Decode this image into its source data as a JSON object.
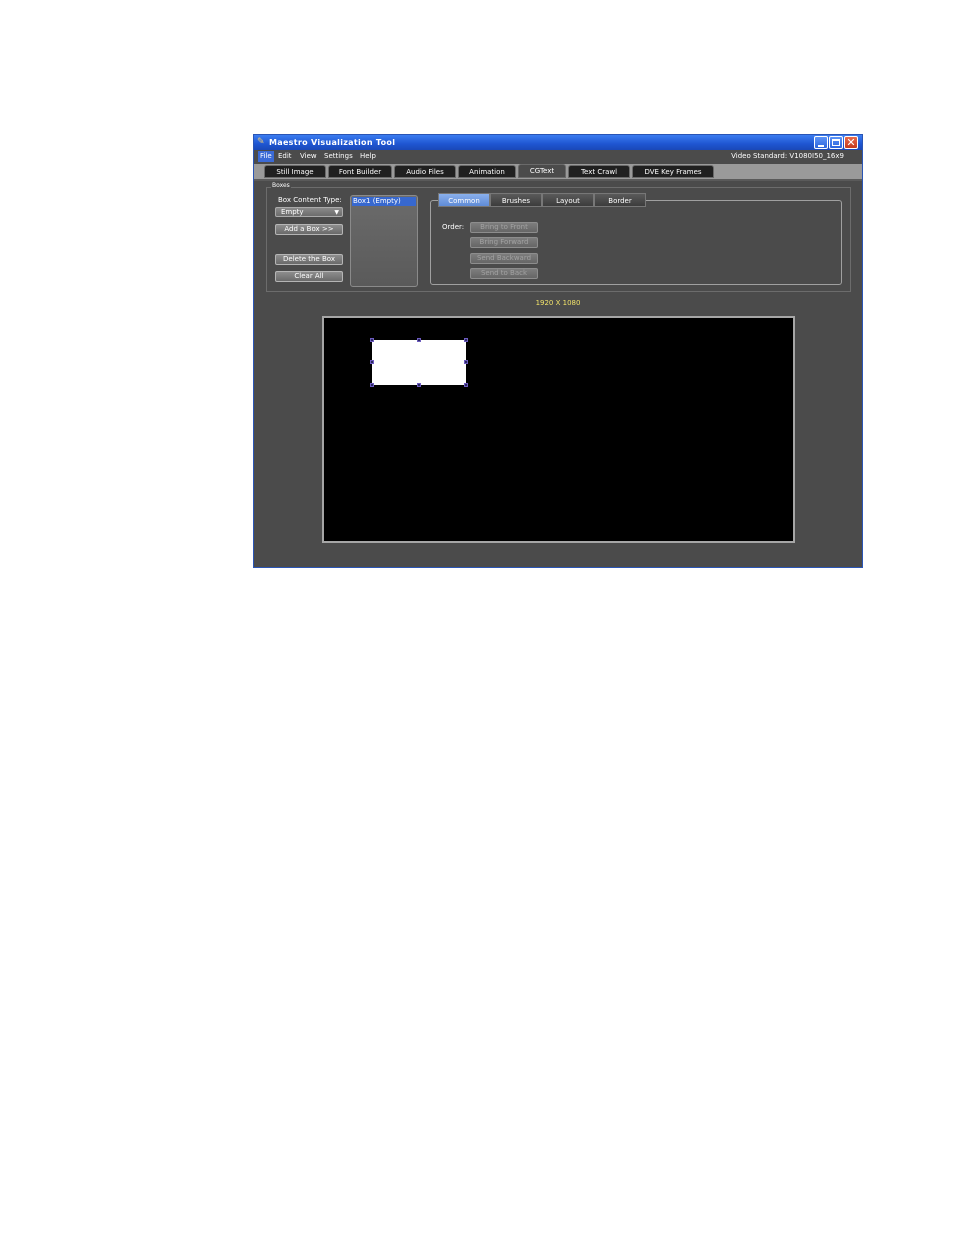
{
  "window": {
    "title": "Maestro Visualization Tool"
  },
  "menu": {
    "items": [
      "File",
      "Edit",
      "View",
      "Settings",
      "Help"
    ],
    "video_standard": "Video Standard: V1080I50_16x9"
  },
  "tabs": [
    "Still Image",
    "Font Builder",
    "Audio Files",
    "Animation",
    "CGText",
    "Text Crawl",
    "DVE Key Frames"
  ],
  "selected_tab": "CGText",
  "boxes": {
    "group_label": "Boxes",
    "content_type_label": "Box Content Type:",
    "content_type_value": "Empty",
    "add_button": "Add a Box >>",
    "delete_button": "Delete the Box",
    "clear_button": "Clear All",
    "list": [
      "Box1 (Empty)"
    ]
  },
  "panel": {
    "tabs": [
      "Common",
      "Brushes",
      "Layout",
      "Border"
    ],
    "selected_tab": "Common",
    "order_label": "Order:",
    "order_buttons": [
      "Bring to Front",
      "Bring Forward",
      "Send Backward",
      "Send to Back"
    ]
  },
  "canvas": {
    "resolution_label": "1920 X 1080"
  },
  "colors": {
    "titlebar": "#1e55d1",
    "selection": "#3768cf",
    "resolution_label": "#f2e36a",
    "canvas": "#000000"
  }
}
